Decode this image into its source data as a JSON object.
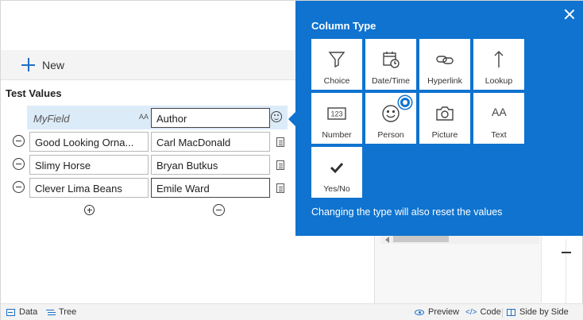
{
  "toolbar": {
    "new_label": "New"
  },
  "section": {
    "title": "Test Values"
  },
  "grid": {
    "header": {
      "field": "MyField",
      "type_glyph": "AA",
      "value": "Author"
    },
    "rows": [
      {
        "field": "Good Looking Orna...",
        "value": "Carl MacDonald"
      },
      {
        "field": "Slimy Horse",
        "value": "Bryan Butkus"
      },
      {
        "field": "Clever Lima Beans",
        "value": "Emile Ward"
      }
    ]
  },
  "popup": {
    "title": "Column Type",
    "note": "Changing the type will also reset the values",
    "selected": "Person",
    "accent_color": "#0f73cf",
    "types": [
      {
        "label": "Choice",
        "icon": "funnel-icon"
      },
      {
        "label": "Date/Time",
        "icon": "calendar-clock-icon"
      },
      {
        "label": "Hyperlink",
        "icon": "link-icon"
      },
      {
        "label": "Lookup",
        "icon": "arrow-up-icon"
      },
      {
        "label": "Number",
        "icon": "number-123-icon"
      },
      {
        "label": "Person",
        "icon": "smiley-icon"
      },
      {
        "label": "Picture",
        "icon": "camera-icon"
      },
      {
        "label": "Text",
        "icon": "text-aa-icon"
      },
      {
        "label": "Yes/No",
        "icon": "checkmark-icon"
      }
    ],
    "number_glyph": "123",
    "text_glyph": "AA"
  },
  "statusbar": {
    "data_label": "Data",
    "tree_label": "Tree",
    "preview_label": "Preview",
    "code_glyph": "</>",
    "code_label": "Code",
    "side_label": "Side by Side"
  }
}
